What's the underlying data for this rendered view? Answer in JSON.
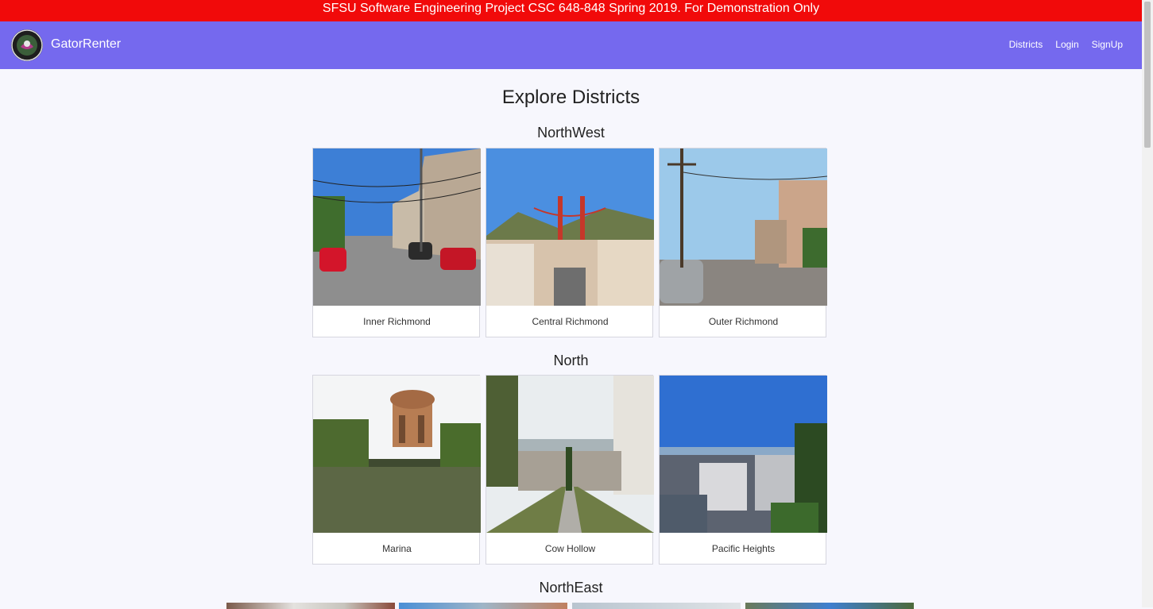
{
  "banner": {
    "text": "SFSU Software Engineering Project CSC 648-848 Spring 2019. For Demonstration Only"
  },
  "navbar": {
    "brand": "GatorRenter",
    "links": {
      "districts": "Districts",
      "login": "Login",
      "signup": "SignUp"
    }
  },
  "page": {
    "title": "Explore Districts"
  },
  "sections": [
    {
      "title": "NorthWest",
      "cards": [
        {
          "label": "Inner Richmond"
        },
        {
          "label": "Central Richmond"
        },
        {
          "label": "Outer Richmond"
        }
      ]
    },
    {
      "title": "North",
      "cards": [
        {
          "label": "Marina"
        },
        {
          "label": "Cow Hollow"
        },
        {
          "label": "Pacific Heights"
        }
      ]
    },
    {
      "title": "NorthEast"
    }
  ],
  "colors": {
    "banner": "#f10a0a",
    "navbar": "#7569ee",
    "background": "#f7f7fd"
  }
}
